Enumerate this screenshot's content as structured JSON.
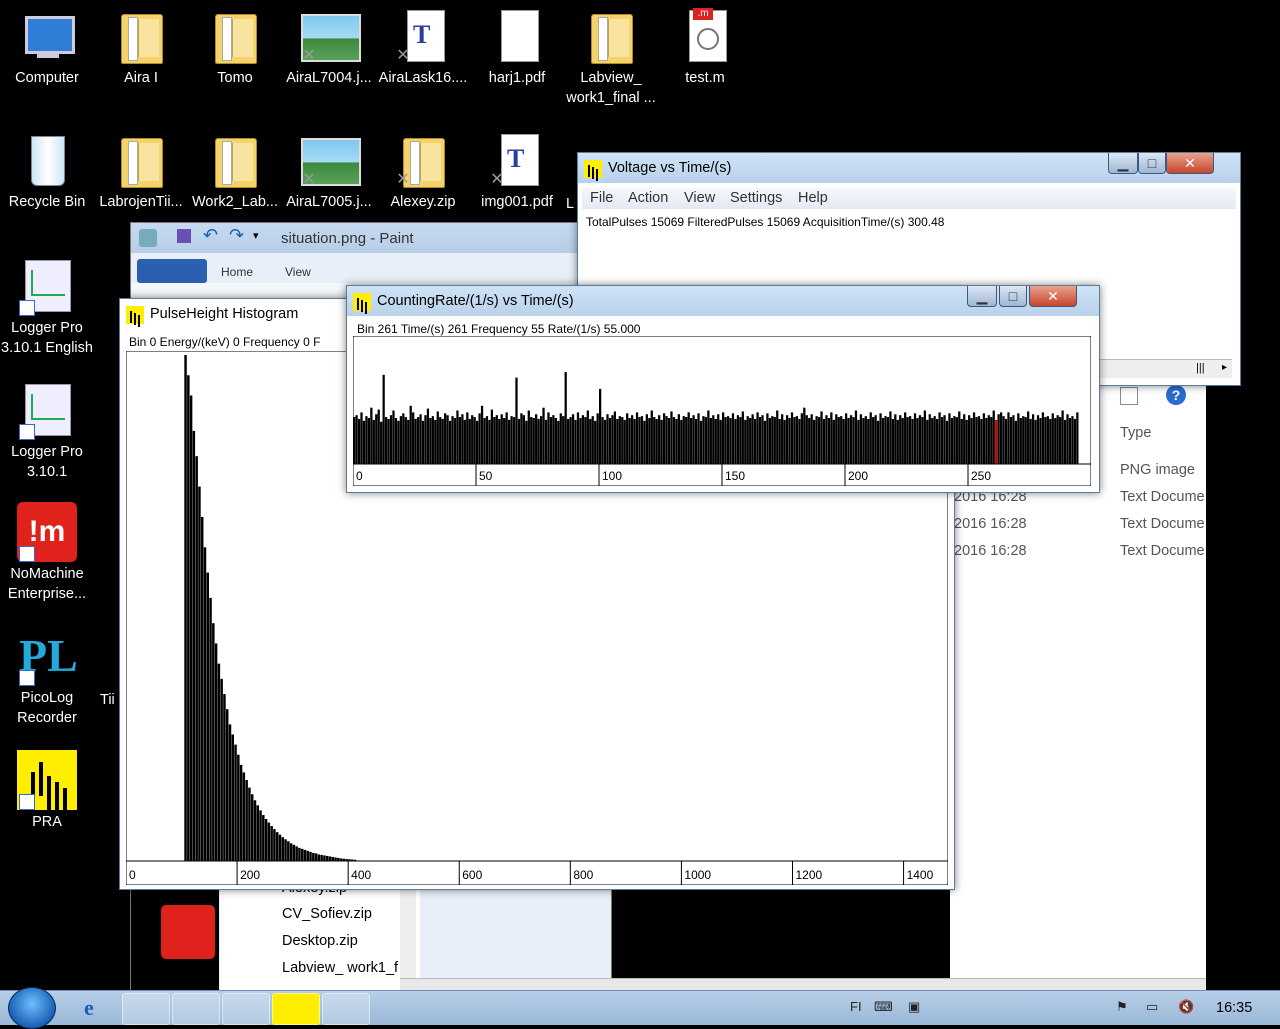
{
  "desktop": {
    "icons": [
      {
        "label": "Computer",
        "kind": "computer"
      },
      {
        "label": "Aira I",
        "kind": "folder"
      },
      {
        "label": "Tomo",
        "kind": "folder"
      },
      {
        "label": "AiraL7004.j...",
        "kind": "picture"
      },
      {
        "label": "AiraLask16....",
        "kind": "tex"
      },
      {
        "label": "harj1.pdf",
        "kind": "pdf"
      },
      {
        "label": "Labview_",
        "label2": "work1_final ...",
        "kind": "zip"
      },
      {
        "label": "test.m",
        "kind": "matlab",
        "badge": ".m"
      },
      {
        "label": "Recycle Bin",
        "kind": "recycle"
      },
      {
        "label": "LabrojenTii...",
        "kind": "folder"
      },
      {
        "label": "Work2_Lab...",
        "kind": "folder"
      },
      {
        "label": "AiraL7005.j...",
        "kind": "picture"
      },
      {
        "label": "Alexey.zip",
        "kind": "zip"
      },
      {
        "label": "img001.pdf",
        "kind": "tex"
      },
      {
        "label": "Logger Pro",
        "label2": "3.10.1 English",
        "kind": "logger"
      },
      {
        "label": "Logger Pro",
        "label2": "3.10.1",
        "kind": "logger"
      },
      {
        "label": "NoMachine",
        "label2": "Enterprise...",
        "kind": "nomachine"
      },
      {
        "label": "PicoLog",
        "label2": "Recorder",
        "kind": "picolog"
      },
      {
        "label": "PRA",
        "kind": "pra"
      }
    ],
    "partial_labels": [
      "L",
      "Tii"
    ]
  },
  "paint": {
    "title": "situation.png - Paint",
    "tabs": [
      "Home",
      "View"
    ]
  },
  "explorer": {
    "column_type": "Type",
    "rows": [
      {
        "date": "",
        "type": "PNG image"
      },
      {
        "date": "2016 16:28",
        "type": "Text Docume"
      },
      {
        "date": "2016 16:28",
        "type": "Text Docume"
      },
      {
        "date": "2016 16:28",
        "type": "Text Docume"
      }
    ],
    "files": [
      "Alexey.zip",
      "CV_Sofiev.zip",
      "Desktop.zip",
      "Labview_ work1_f"
    ]
  },
  "voltage_window": {
    "title": "Voltage vs Time/(s)",
    "menu": [
      "File",
      "Action",
      "View",
      "Settings",
      "Help"
    ],
    "status": "TotalPulses 15069  FilteredPulses 15069  AcquisitionTime/(s) 300.48"
  },
  "histogram_window": {
    "title": "PulseHeight Histogram",
    "readout": "Bin 0  Energy/(keV) 0  Frequency 0  F",
    "ticks": [
      "0",
      "200",
      "400",
      "600",
      "800",
      "1000",
      "1200",
      "1400"
    ]
  },
  "rate_window": {
    "title": "CountingRate/(1/s) vs Time/(s)",
    "readout": "Bin 261  Time/(s) 261  Frequency 55  Rate/(1/s) 55.000",
    "ticks": [
      "0",
      "50",
      "100",
      "150",
      "200",
      "250"
    ],
    "highlight_color": "#cc0000"
  },
  "chart_data": [
    {
      "type": "bar",
      "title": "PulseHeight Histogram",
      "xlabel": "Energy/(keV)",
      "xlim": [
        0,
        1480
      ],
      "x_start": 105,
      "x_step": 5,
      "note": "histogram of pulse heights, sharp peak near 110 then exponential decay",
      "values": [
        100,
        96,
        92,
        85,
        80,
        74,
        68,
        62,
        57,
        52,
        47,
        43,
        39,
        36,
        33,
        30,
        27,
        25,
        23,
        21,
        19,
        17.5,
        16,
        14.5,
        13.2,
        12,
        11,
        10,
        9.1,
        8.3,
        7.6,
        6.9,
        6.3,
        5.7,
        5.2,
        4.7,
        4.3,
        3.9,
        3.5,
        3.2,
        2.9,
        2.6,
        2.4,
        2.2,
        2.0,
        1.8,
        1.6,
        1.5,
        1.3,
        1.2,
        1.1,
        1.0,
        0.9,
        0.8,
        0.7,
        0.6,
        0.5,
        0.45,
        0.4,
        0.35,
        0.3,
        0.25
      ],
      "ylim": [
        0,
        100
      ]
    },
    {
      "type": "bar",
      "title": "CountingRate/(1/s) vs Time/(s)",
      "xlabel": "Time/(s)",
      "ylabel": "Rate/(1/s)",
      "xlim": [
        0,
        300
      ],
      "highlight_index": 261,
      "highlight_value": 55,
      "ylim": [
        0,
        130
      ],
      "values": [
        50,
        52,
        48,
        55,
        46,
        51,
        49,
        60,
        47,
        53,
        58,
        45,
        95,
        50,
        48,
        52,
        57,
        49,
        46,
        51,
        54,
        50,
        47,
        62,
        55,
        48,
        50,
        53,
        46,
        52,
        59,
        49,
        51,
        47,
        56,
        50,
        48,
        54,
        52,
        46,
        51,
        49,
        57,
        50,
        53,
        47,
        55,
        48,
        52,
        50,
        46,
        54,
        62,
        49,
        51,
        47,
        58,
        50,
        52,
        48,
        53,
        49,
        55,
        47,
        51,
        50,
        92,
        48,
        54,
        52,
        46,
        57,
        50,
        49,
        53,
        48,
        51,
        60,
        47,
        55,
        50,
        52,
        49,
        46,
        54,
        51,
        98,
        48,
        50,
        53,
        47,
        55,
        49,
        52,
        50,
        57,
        48,
        51,
        46,
        54,
        80,
        50,
        47,
        53,
        49,
        52,
        56,
        48,
        51,
        50,
        47,
        54,
        49,
        52,
        48,
        55,
        50,
        51,
        46,
        53,
        49,
        57,
        50,
        48,
        52,
        47,
        54,
        51,
        49,
        56,
        50,
        48,
        53,
        47,
        51,
        50,
        55,
        49,
        52,
        48,
        54,
        46,
        51,
        50,
        57,
        49,
        52,
        48,
        53,
        47,
        55,
        50,
        51,
        49,
        54,
        48,
        52,
        50,
        56,
        47,
        51,
        49,
        53,
        48,
        55,
        50,
        52,
        46,
        54,
        49,
        51,
        50,
        57,
        48,
        53,
        47,
        52,
        49,
        55,
        50,
        51,
        48,
        54,
        60,
        52,
        49,
        53,
        47,
        51,
        50,
        56,
        48,
        52,
        49,
        55,
        47,
        53,
        50,
        51,
        48,
        54,
        49,
        52,
        50,
        57,
        47,
        53,
        49,
        51,
        48,
        55,
        50,
        52,
        46,
        54,
        49,
        51,
        50,
        56,
        48,
        53,
        47,
        52,
        49,
        55,
        50,
        51,
        48,
        54,
        49,
        52,
        50,
        57,
        47,
        53,
        49,
        51,
        48,
        55,
        50,
        52,
        46,
        54,
        49,
        51,
        50,
        56,
        48,
        53,
        47,
        52,
        49,
        55,
        50,
        51,
        48,
        54,
        49,
        52,
        50,
        57,
        47,
        53,
        55,
        51,
        48,
        55,
        50,
        52,
        46,
        54,
        49,
        51,
        50,
        56,
        48,
        53,
        47,
        52,
        49,
        55,
        50,
        51,
        48,
        54,
        49,
        52,
        50,
        57,
        47,
        53,
        49,
        51,
        48,
        55
      ]
    }
  ],
  "taskbar": {
    "lang": "FI",
    "clock": "16:35"
  }
}
